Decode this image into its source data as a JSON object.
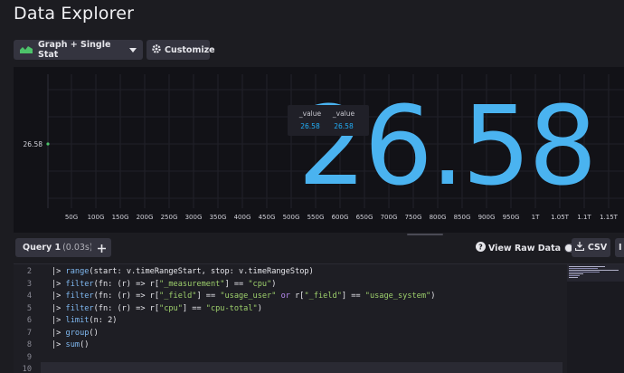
{
  "page": {
    "title": "Data Explorer"
  },
  "toolbar": {
    "visualization_label": "Graph + Single Stat",
    "customize_label": "Customize"
  },
  "chart_data": {
    "type": "line",
    "y_ticks": [
      "26.58"
    ],
    "x_ticks": [
      "50G",
      "100G",
      "150G",
      "200G",
      "250G",
      "300G",
      "350G",
      "400G",
      "450G",
      "500G",
      "550G",
      "600G",
      "650G",
      "700G",
      "750G",
      "800G",
      "850G",
      "900G",
      "950G",
      "1T",
      "1.05T",
      "1.1T",
      "1.15T"
    ],
    "series": [
      {
        "values": [
          26.58
        ]
      }
    ],
    "grid": true
  },
  "tooltip": {
    "columns": [
      {
        "header": "_value",
        "value": "26.58"
      },
      {
        "header": "_value",
        "value": "26.58"
      }
    ]
  },
  "single_stat": {
    "value": "26.58",
    "color": "#4ab3f0"
  },
  "query_bar": {
    "tab_label": "Query 1",
    "tab_duration": "(0.03s)",
    "view_raw_label": "View Raw Data",
    "csv_label": "CSV",
    "extra_label": "I"
  },
  "editor": {
    "lines": [
      {
        "num": "2",
        "text": "|> range(start: v.timeRangeStart, stop: v.timeRangeStop)"
      },
      {
        "num": "3",
        "text": "|> filter(fn: (r) => r[\"_measurement\"] == \"cpu\")"
      },
      {
        "num": "4",
        "text": "|> filter(fn: (r) => r[\"_field\"] == \"usage_user\" or r[\"_field\"] == \"usage_system\")"
      },
      {
        "num": "5",
        "text": "|> filter(fn: (r) => r[\"cpu\"] == \"cpu-total\")"
      },
      {
        "num": "6",
        "text": "|> limit(n: 2)"
      },
      {
        "num": "7",
        "text": "|> group()"
      },
      {
        "num": "8",
        "text": "|> sum()"
      },
      {
        "num": "9",
        "text": ""
      },
      {
        "num": "10",
        "text": ""
      }
    ]
  }
}
